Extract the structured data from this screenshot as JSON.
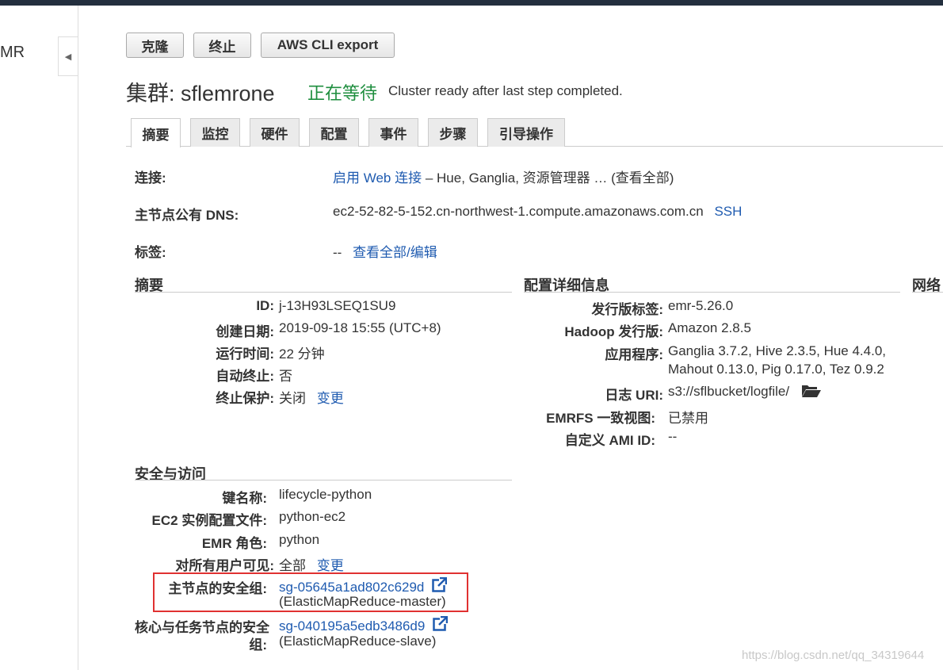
{
  "sidebar": {
    "label_partial": "MR"
  },
  "toolbar": {
    "clone": "克隆",
    "terminate": "终止",
    "cli_export": "AWS CLI export"
  },
  "cluster": {
    "title": "集群: sflemrone",
    "status": "正在等待",
    "status_message": "Cluster ready after last step completed."
  },
  "tabs": [
    "摘要",
    "监控",
    "硬件",
    "配置",
    "事件",
    "步骤",
    "引导操作"
  ],
  "top": {
    "connect_label": "连接:",
    "connect_link": "启用 Web 连接",
    "connect_rest": "– Hue, Ganglia, 资源管理器 … (查看全部)",
    "dns_label": "主节点公有 DNS:",
    "dns_value": "ec2-52-82-5-152.cn-northwest-1.compute.amazonaws.com.cn",
    "ssh": "SSH",
    "tags_label": "标签:",
    "tags_value": "--",
    "tags_link": "查看全部/编辑"
  },
  "summary": {
    "title": "摘要",
    "rows": [
      {
        "label": "ID:",
        "value": "j-13H93LSEQ1SU9"
      },
      {
        "label": "创建日期:",
        "value": "2019-09-18 15:55 (UTC+8)"
      },
      {
        "label": "运行时间:",
        "value": "22 分钟"
      },
      {
        "label": "自动终止:",
        "value": "否"
      },
      {
        "label": "终止保护:",
        "value": "关闭",
        "link": "变更"
      }
    ]
  },
  "config": {
    "title": "配置详细信息",
    "rows": [
      {
        "label": "发行版标签:",
        "value": "emr-5.26.0"
      },
      {
        "label": "Hadoop 发行版:",
        "value": "Amazon 2.8.5"
      },
      {
        "label": "应用程序:",
        "value": "Ganglia 3.7.2, Hive 2.3.5, Hue 4.4.0,",
        "value2": "Mahout 0.13.0, Pig 0.17.0, Tez 0.9.2"
      },
      {
        "label": "日志 URI:",
        "value": "s3://sflbucket/logfile/"
      },
      {
        "label": "EMRFS 一致视图:",
        "value": "已禁用"
      },
      {
        "label": "自定义 AMI ID:",
        "value": "--"
      }
    ]
  },
  "network": {
    "title_partial": "网络"
  },
  "security": {
    "title": "安全与访问",
    "rows": [
      {
        "label": "键名称:",
        "value": "lifecycle-python"
      },
      {
        "label": "EC2 实例配置文件:",
        "value": "python-ec2"
      },
      {
        "label": "EMR 角色:",
        "value": "python"
      },
      {
        "label": "对所有用户可见:",
        "value": "全部",
        "link": "变更"
      }
    ],
    "master_sg": {
      "label": "主节点的安全组:",
      "link": "sg-05645a1ad802c629d",
      "sub": "(ElasticMapReduce-master)"
    },
    "slave_sg": {
      "label1": "核心与任务节点的安全",
      "label2": "组:",
      "link": "sg-040195a5edb3486d9",
      "sub": "(ElasticMapReduce-slave)"
    }
  },
  "watermark": "https://blog.csdn.net/qq_34319644",
  "colors": {
    "link": "#1f5bb0",
    "status": "#1e8e3e",
    "highlight": "#e03131",
    "topbar": "#232f3e"
  }
}
